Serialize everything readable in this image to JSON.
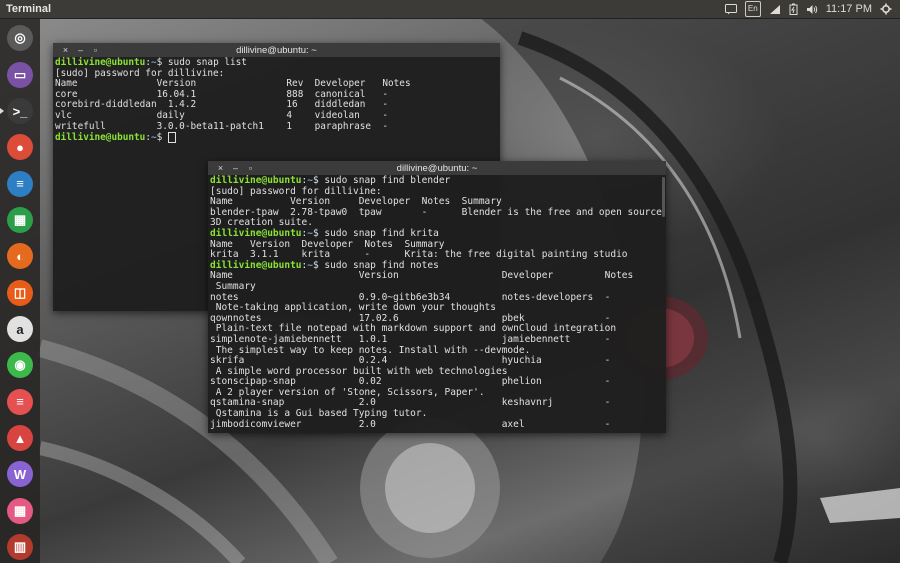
{
  "top_panel": {
    "app_title": "Terminal",
    "keyboard_label": "En",
    "clock": "11:17 PM"
  },
  "launcher": [
    {
      "name": "ubuntu-dash",
      "glyph": "◎",
      "color": "#5a5a5a"
    },
    {
      "name": "files",
      "glyph": "▭",
      "color": "#7a52a5"
    },
    {
      "name": "terminal",
      "glyph": ">_",
      "color": "#3a3a3a"
    },
    {
      "name": "chrome",
      "glyph": "●",
      "color": "#dd4b39"
    },
    {
      "name": "libreoffice-writer",
      "glyph": "≡",
      "color": "#2d7ec2"
    },
    {
      "name": "libreoffice-calc",
      "glyph": "▦",
      "color": "#2c9e4a"
    },
    {
      "name": "firefox",
      "glyph": "◐",
      "color": "#e66a1e"
    },
    {
      "name": "software-center",
      "glyph": "◫",
      "color": "#e85c1a"
    },
    {
      "name": "amazon",
      "glyph": "a",
      "color": "#e1e1e1"
    },
    {
      "name": "settings-toggle",
      "glyph": "◉",
      "color": "#3db84a"
    },
    {
      "name": "app-red",
      "glyph": "≡",
      "color": "#e55050"
    },
    {
      "name": "app-flask",
      "glyph": "▲",
      "color": "#d8443f"
    },
    {
      "name": "app-w",
      "glyph": "W",
      "color": "#8a63d2"
    },
    {
      "name": "calculator",
      "glyph": "▦",
      "color": "#e55a84"
    },
    {
      "name": "trash",
      "glyph": "▥",
      "color": "#b33a2c"
    }
  ],
  "terminal1": {
    "title": "dillivine@ubuntu: ~",
    "buttons": {
      "close": "×",
      "minimize": "–",
      "maximize": "▫"
    },
    "lines": [
      {
        "user": "dillivine@ubuntu",
        "path": "~",
        "cmd": "$ sudo snap list"
      },
      {
        "text": "[sudo] password for dillivine:"
      },
      {
        "text": "Name              Version                Rev  Developer   Notes"
      },
      {
        "text": "core              16.04.1                888  canonical   -"
      },
      {
        "text": "corebird-diddledan  1.4.2                16   diddledan   -"
      },
      {
        "text": "vlc               daily                  4    videolan    -"
      },
      {
        "text": "writefull         3.0.0-beta11-patch1    1    paraphrase  -"
      },
      {
        "user": "dillivine@ubuntu",
        "path": "~",
        "cmd": "$ ",
        "cursor": true
      }
    ]
  },
  "terminal2": {
    "title": "dillivine@ubuntu: ~",
    "buttons": {
      "close": "×",
      "minimize": "–",
      "maximize": "▫"
    },
    "lines": [
      {
        "user": "dillivine@ubuntu",
        "path": "~",
        "cmd": "$ sudo snap find blender"
      },
      {
        "text": "[sudo] password for dillivine:"
      },
      {
        "text": "Name          Version     Developer  Notes  Summary"
      },
      {
        "text": "blender-tpaw  2.78-tpaw0  tpaw       -      Blender is the free and open source"
      },
      {
        "text": "3D creation suite."
      },
      {
        "user": "dillivine@ubuntu",
        "path": "~",
        "cmd": "$ sudo snap find krita"
      },
      {
        "text": "Name   Version  Developer  Notes  Summary"
      },
      {
        "text": "krita  3.1.1    krita      -      Krita: the free digital painting studio"
      },
      {
        "user": "dillivine@ubuntu",
        "path": "~",
        "cmd": "$ sudo snap find notes"
      },
      {
        "text": "Name                      Version                  Developer         Notes"
      },
      {
        "text": " Summary"
      },
      {
        "text": "notes                     0.9.0~gitb6e3b34         notes-developers  -"
      },
      {
        "text": " Note-taking application, write down your thoughts"
      },
      {
        "text": "qownnotes                 17.02.6                  pbek              -"
      },
      {
        "text": " Plain-text file notepad with markdown support and ownCloud integration"
      },
      {
        "text": "simplenote-jamiebennett   1.0.1                    jamiebennett      -"
      },
      {
        "text": " The simplest way to keep notes. Install with --devmode."
      },
      {
        "text": "skrifa                    0.2.4                    hyuchia           -"
      },
      {
        "text": " A simple word processor built with web technologies"
      },
      {
        "text": "stonscipap-snap           0.02                     phelion           -"
      },
      {
        "text": " A 2 player version of 'Stone, Scissors, Paper'."
      },
      {
        "text": "qstamina-snap             2.0                      keshavnrj         -"
      },
      {
        "text": " Qstamina is a Gui based Typing tutor."
      },
      {
        "text": "jimbodicomviewer          2.0                      axel              -"
      }
    ]
  }
}
